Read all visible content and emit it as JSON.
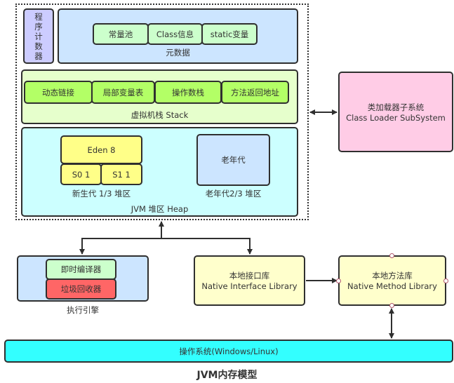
{
  "title": "JVM内存模型",
  "runtime_area": {
    "program_counter": {
      "label": "程序计数器",
      "chars": [
        "程",
        "序",
        "计",
        "数",
        "器"
      ]
    },
    "metadata": {
      "label": "元数据",
      "items": [
        "常量池",
        "Class信息",
        "static变量"
      ]
    },
    "stack": {
      "label": "虚拟机栈 Stack",
      "items": [
        "动态链接",
        "局部变量表",
        "操作数栈",
        "方法返回地址"
      ]
    },
    "heap": {
      "label": "JVM 堆区 Heap",
      "young": {
        "eden": "Eden 8",
        "s0": "S0  1",
        "s1": "S1  1",
        "label": "新生代 1/3 堆区"
      },
      "old": {
        "box": "老年代",
        "label": "老年代2/3 堆区"
      }
    }
  },
  "class_loader": {
    "line1": "类加载器子系统",
    "line2": "Class Loader SubSystem"
  },
  "execution_engine": {
    "label": "执行引擎",
    "jit": "即时编译器",
    "gc": "垃圾回收器"
  },
  "native_interface": {
    "line1": "本地接口库",
    "line2": "Native Interface Library"
  },
  "native_method": {
    "line1": "本地方法库",
    "line2": "Native Method Library"
  },
  "os": {
    "label": "操作系统(Windows/Linux)"
  },
  "colors": {
    "pc": "#ccccff",
    "metadata": "#cce5ff",
    "metadata_item": "#ccffcc",
    "stack": "#e6ffcc",
    "stack_item": "#b3ff66",
    "heap": "#ccffff",
    "eden": "#ffff88",
    "old": "#cce5ff",
    "class_loader": "#ffcce6",
    "jit": "#ccffcc",
    "gc": "#ff6666",
    "native": "#ffffcc",
    "os": "#33ffff"
  }
}
